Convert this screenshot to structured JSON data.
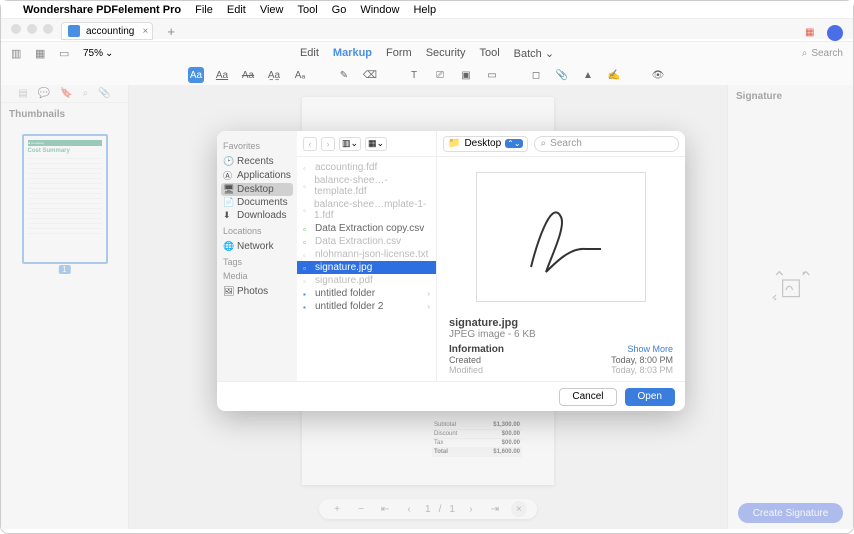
{
  "menubar": {
    "app_name": "Wondershare PDFelement Pro",
    "items": [
      "File",
      "Edit",
      "View",
      "Tool",
      "Go",
      "Window",
      "Help"
    ]
  },
  "tab": {
    "title": "accounting"
  },
  "zoom": {
    "value": "75%"
  },
  "main_tabs": [
    "Edit",
    "Markup",
    "Form",
    "Security",
    "Tool",
    "Batch"
  ],
  "main_tabs_active": "Markup",
  "search": {
    "placeholder": "Search"
  },
  "thumbnails": {
    "title": "Thumbnails",
    "page_badge": "1",
    "doc_title": "Cost Summary"
  },
  "doc_table": [
    {
      "k": "Subtotal",
      "v": "$1,300.00"
    },
    {
      "k": "Discount",
      "v": "$00.00"
    },
    {
      "k": "Tax",
      "v": "$00.00"
    },
    {
      "k": "Total",
      "v": "$1,600.00"
    }
  ],
  "pager": {
    "current": "1",
    "total": "1"
  },
  "rightpane": {
    "title": "Signature",
    "button": "Create Signature"
  },
  "dialog": {
    "sidebar": {
      "favorites": "Favorites",
      "items_fav": [
        "Recents",
        "Applications",
        "Desktop",
        "Documents",
        "Downloads"
      ],
      "locations": "Locations",
      "items_loc": [
        "Network"
      ],
      "tags": "Tags",
      "media": "Media",
      "items_media": [
        "Photos"
      ]
    },
    "location": "Desktop",
    "search_placeholder": "Search",
    "files": [
      {
        "name": "accounting.fdf",
        "dim": true
      },
      {
        "name": "balance-shee…-template.fdf",
        "dim": true
      },
      {
        "name": "balance-shee…mplate-1-1.fdf",
        "dim": true
      },
      {
        "name": "Data Extraction copy.csv",
        "dim": false,
        "green": true
      },
      {
        "name": "Data Extraction.csv",
        "dim": true,
        "green": true
      },
      {
        "name": "nlohmann-json-license.txt",
        "dim": true
      },
      {
        "name": "signature.jpg",
        "dim": false,
        "sel": true
      },
      {
        "name": "signature.pdf",
        "dim": true
      },
      {
        "name": "untitled folder",
        "dim": false,
        "folder": true
      },
      {
        "name": "untitled folder 2",
        "dim": false,
        "folder": true
      }
    ],
    "preview": {
      "filename": "signature.jpg",
      "meta": "JPEG image - 6 KB",
      "info_label": "Information",
      "show_more": "Show More",
      "created_k": "Created",
      "created_v": "Today, 8:00 PM",
      "modified_k": "Modified",
      "modified_v": "Today, 8:03 PM"
    },
    "cancel": "Cancel",
    "open": "Open"
  }
}
